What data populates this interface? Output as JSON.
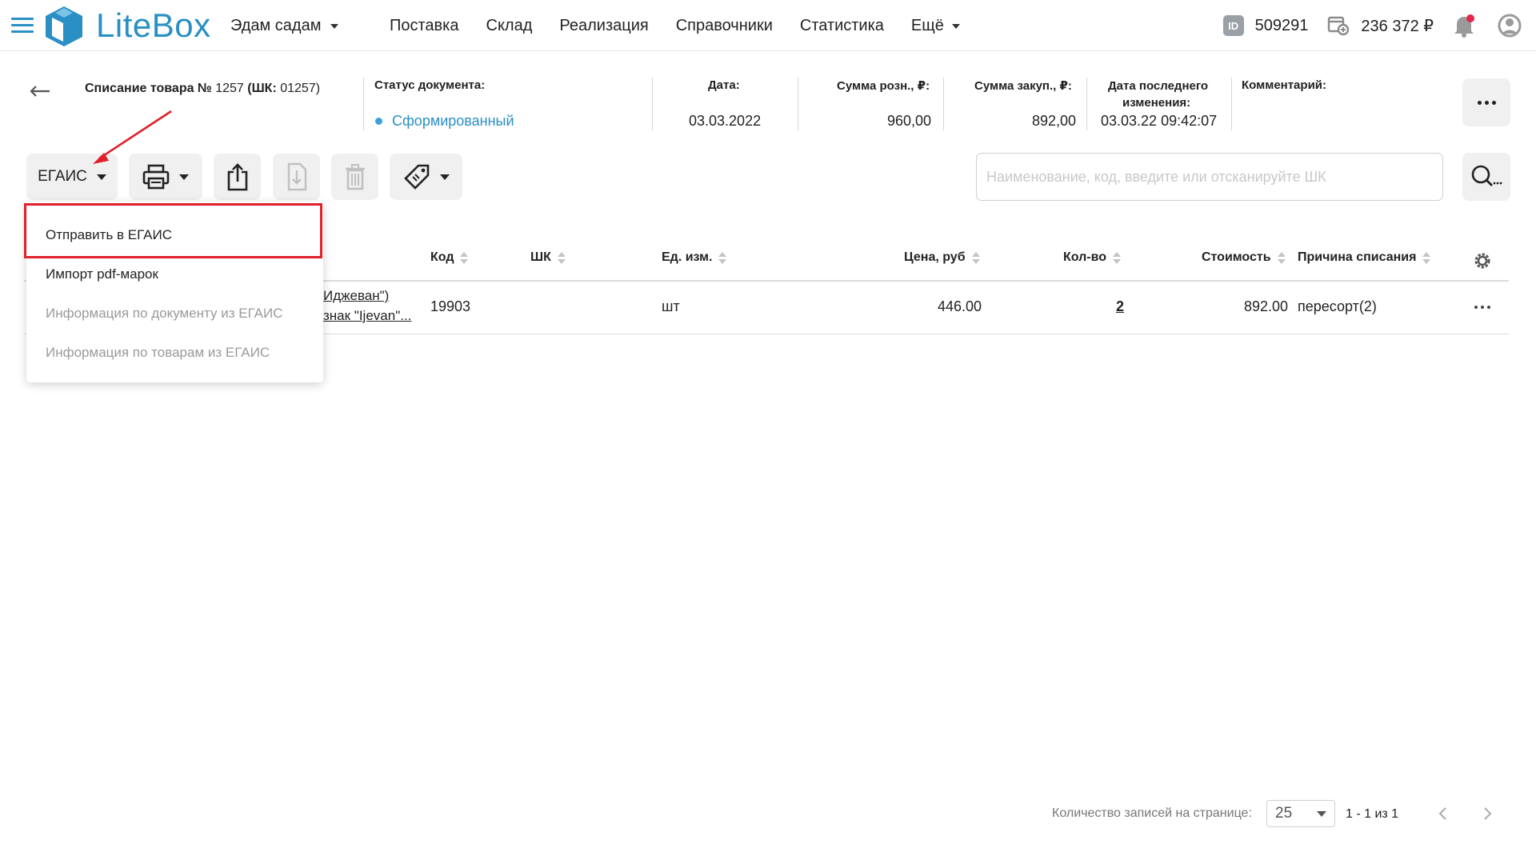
{
  "app": {
    "logo_text": "LiteBox",
    "organization": "Эдам садам",
    "nav": [
      "Поставка",
      "Склад",
      "Реализация",
      "Справочники",
      "Статистика",
      "Ещё"
    ],
    "account_id_badge": "ID",
    "account_id": "509291",
    "balance": "236 372 ₽"
  },
  "document": {
    "title_bold": "Списание товара №",
    "title_number": "1257",
    "title_barcode_label": "(ШК:",
    "title_barcode": "01257)",
    "status_label": "Статус документа:",
    "status_value": "Сформированный",
    "date_label": "Дата:",
    "date_value": "03.03.2022",
    "retail_sum_label": "Сумма розн., ₽:",
    "retail_sum_value": "960,00",
    "purchase_sum_label": "Сумма закуп., ₽:",
    "purchase_sum_value": "892,00",
    "last_change_label_1": "Дата последнего",
    "last_change_label_2": "изменения:",
    "last_change_value": "03.03.22 09:42:07",
    "comment_label": "Комментарий:"
  },
  "toolbar": {
    "egais_label": "ЕГАИС",
    "search_placeholder": "Наименование, код, введите или отсканируйте ШК"
  },
  "dropdown": {
    "items": [
      {
        "label": "Отправить в ЕГАИС",
        "enabled": true
      },
      {
        "label": "Импорт pdf-марок",
        "enabled": true
      },
      {
        "label": "Информация по документу из ЕГАИС",
        "enabled": false
      },
      {
        "label": "Информация по товарам из ЕГАИС",
        "enabled": false
      }
    ]
  },
  "table": {
    "headers": {
      "code": "Код",
      "barcode": "ШК",
      "unit": "Ед. изм.",
      "price": "Цена, руб",
      "qty": "Кол-во",
      "cost": "Стоимость",
      "reason": "Причина списания"
    },
    "rows": [
      {
        "name_line1": "Иджеван\")",
        "name_line2": "знак \"Ijevan\"...",
        "code": "19903",
        "barcode": "",
        "unit": "шт",
        "price": "446.00",
        "qty": "2",
        "cost": "892.00",
        "reason": "пересорт(2)"
      }
    ]
  },
  "pagination": {
    "per_page_label": "Количество записей на странице:",
    "per_page_value": "25",
    "range": "1 - 1 из 1"
  },
  "colors": {
    "accent": "#2a8fc4",
    "highlight": "#e0202a",
    "button_bg": "#f0f0f0"
  }
}
